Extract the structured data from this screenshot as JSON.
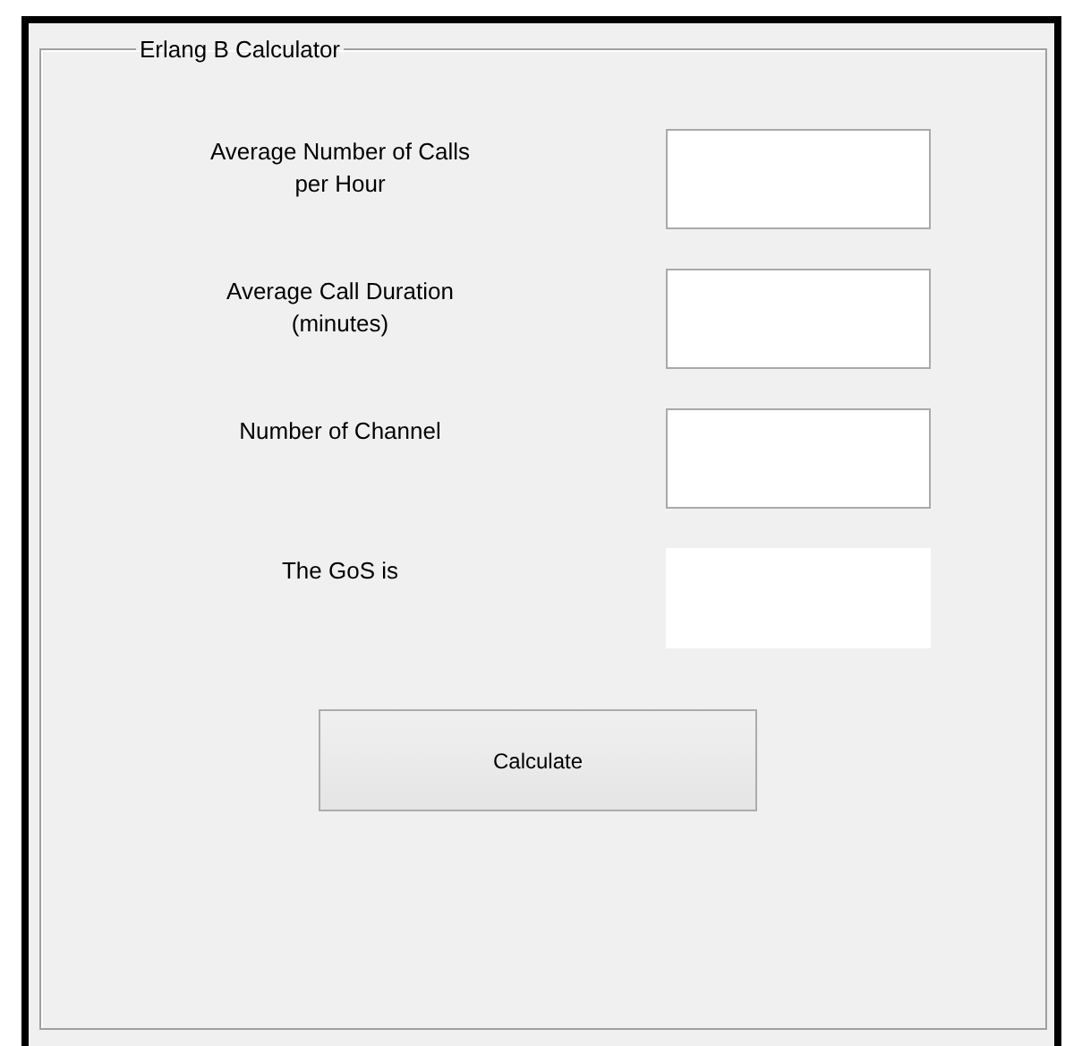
{
  "group": {
    "title": "Erlang B Calculator"
  },
  "rows": [
    {
      "label": "Average Number of Calls\nper Hour",
      "kind": "input"
    },
    {
      "label": "Average Call Duration\n(minutes)",
      "kind": "input"
    },
    {
      "label": "Number of Channel",
      "kind": "input"
    },
    {
      "label": "The GoS is",
      "kind": "output"
    }
  ],
  "button": {
    "label": "Calculate"
  }
}
